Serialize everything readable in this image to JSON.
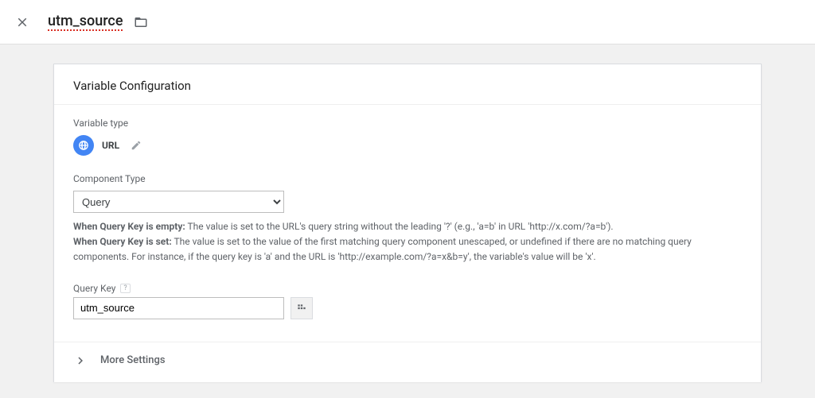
{
  "header": {
    "title": "utm_source"
  },
  "card": {
    "heading": "Variable Configuration",
    "variable_type_label": "Variable type",
    "variable_type_name": "URL",
    "component_type_label": "Component Type",
    "component_type_value": "Query",
    "help_label_1": "When Query Key is empty:",
    "help_text_1": " The value is set to the URL's query string without the leading '?' (e.g., 'a=b' in URL 'http://x.com/?a=b').",
    "help_label_2": "When Query Key is set:",
    "help_text_2": " The value is set to the value of the first matching query component unescaped, or undefined if there are no matching query components. For instance, if the query key is 'a' and the URL is 'http://example.com/?a=x&b=y', the variable's value will be 'x'.",
    "query_key_label": "Query Key",
    "query_key_help": "?",
    "query_key_value": "utm_source",
    "more_settings_label": "More Settings"
  }
}
